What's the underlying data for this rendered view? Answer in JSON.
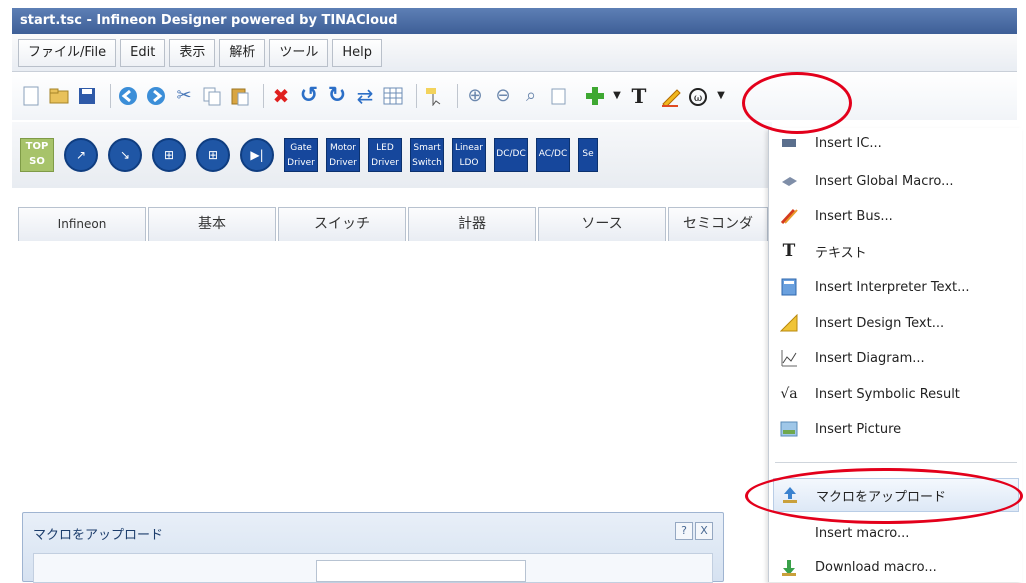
{
  "window": {
    "title": "start.tsc - Infineon Designer powered by TINACloud"
  },
  "menu": [
    "ファイル/File",
    "Edit",
    "表示",
    "解析",
    "ツール",
    "Help"
  ],
  "components": {
    "top": [
      "TOP",
      "SO"
    ],
    "boxes": [
      [
        "Gate",
        "Driver"
      ],
      [
        "Motor",
        "Driver"
      ],
      [
        "LED",
        "Driver"
      ],
      [
        "Smart",
        "Switch"
      ],
      [
        "Linear",
        "LDO"
      ],
      [
        "DC/DC",
        ""
      ],
      [
        "AC/DC",
        ""
      ],
      [
        "Se",
        ""
      ]
    ]
  },
  "tabs": [
    "Infineon",
    "基本",
    "スイッチ",
    "計器",
    "ソース",
    "セミコンダ"
  ],
  "dropdown": {
    "items": [
      {
        "label": "Insert IC...",
        "icon": "ic-icon"
      },
      {
        "label": "Insert Global Macro...",
        "icon": "global-macro-icon"
      },
      {
        "label": "Insert Bus...",
        "icon": "bus-icon"
      },
      {
        "label": "テキスト",
        "icon": "text-icon"
      },
      {
        "label": "Insert Interpreter Text...",
        "icon": "interpreter-icon"
      },
      {
        "label": "Insert Design Text...",
        "icon": "design-text-icon"
      },
      {
        "label": "Insert Diagram...",
        "icon": "diagram-icon"
      },
      {
        "label": "Insert Symbolic Result",
        "icon": "symbolic-icon"
      },
      {
        "label": "Insert Picture",
        "icon": "picture-icon"
      },
      {
        "label": "マクロをアップロード",
        "icon": "upload-macro-icon"
      },
      {
        "label": "Insert macro...",
        "icon": ""
      },
      {
        "label": "Download macro...",
        "icon": "download-macro-icon"
      }
    ]
  },
  "dialog": {
    "title": "マクロをアップロード",
    "help_label": "?",
    "close_label": "X"
  },
  "colors": {
    "accent": "#e3001b",
    "title_bar": "#4a6aa3",
    "component_blue": "#16479c"
  }
}
